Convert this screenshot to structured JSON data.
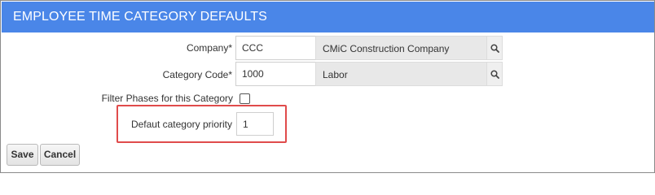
{
  "header": {
    "title": "EMPLOYEE TIME CATEGORY DEFAULTS"
  },
  "form": {
    "company": {
      "label": "Company*",
      "value": "CCC",
      "description": "CMiC Construction Company",
      "lookup_icon": "search-icon"
    },
    "category_code": {
      "label": "Category Code*",
      "value": "1000",
      "description": "Labor",
      "lookup_icon": "search-icon"
    },
    "filter_phases": {
      "label": "Filter Phases for this Category",
      "checked": false
    },
    "default_priority": {
      "label": "Defaut category priority",
      "value": "1"
    }
  },
  "buttons": {
    "save": "Save",
    "cancel": "Cancel"
  },
  "colors": {
    "header_bg": "#4a86e8",
    "highlight_border": "#e04b4b"
  }
}
